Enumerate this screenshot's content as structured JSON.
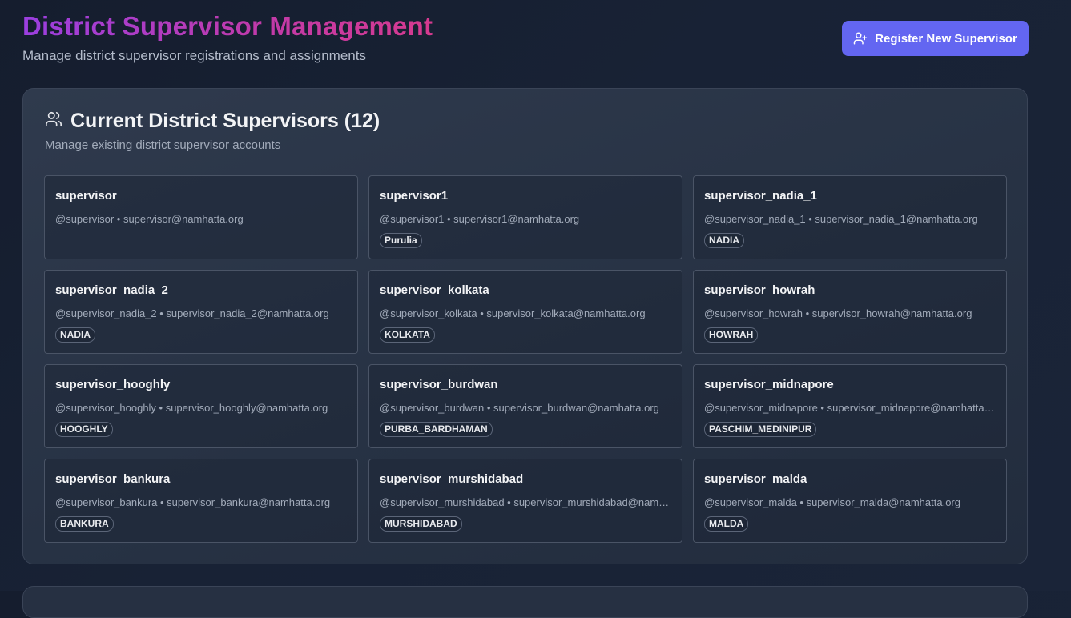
{
  "header": {
    "title": "District Supervisor Management",
    "subtitle": "Manage district supervisor registrations and assignments",
    "register_button": {
      "label": "Register New Supervisor",
      "icon": "user-plus-icon"
    }
  },
  "colors": {
    "accent": "#6366f1",
    "title_gradient_start": "#9b3fe0",
    "title_gradient_end": "#d63a8f",
    "background": "#182235"
  },
  "supervisors_panel": {
    "icon": "users-icon",
    "title": "Current District Supervisors (12)",
    "subtitle": "Manage existing district supervisor accounts",
    "items": [
      {
        "name": "supervisor",
        "meta": "@supervisor • supervisor@namhatta.org",
        "district": ""
      },
      {
        "name": "supervisor1",
        "meta": "@supervisor1 • supervisor1@namhatta.org",
        "district": "Purulia"
      },
      {
        "name": "supervisor_nadia_1",
        "meta": "@supervisor_nadia_1 • supervisor_nadia_1@namhatta.org",
        "district": "NADIA"
      },
      {
        "name": "supervisor_nadia_2",
        "meta": "@supervisor_nadia_2 • supervisor_nadia_2@namhatta.org",
        "district": "NADIA"
      },
      {
        "name": "supervisor_kolkata",
        "meta": "@supervisor_kolkata • supervisor_kolkata@namhatta.org",
        "district": "KOLKATA"
      },
      {
        "name": "supervisor_howrah",
        "meta": "@supervisor_howrah • supervisor_howrah@namhatta.org",
        "district": "HOWRAH"
      },
      {
        "name": "supervisor_hooghly",
        "meta": "@supervisor_hooghly • supervisor_hooghly@namhatta.org",
        "district": "HOOGHLY"
      },
      {
        "name": "supervisor_burdwan",
        "meta": "@supervisor_burdwan • supervisor_burdwan@namhatta.org",
        "district": "PURBA_BARDHAMAN"
      },
      {
        "name": "supervisor_midnapore",
        "meta": "@supervisor_midnapore • supervisor_midnapore@namhatta.org",
        "district": "PASCHIM_MEDINIPUR"
      },
      {
        "name": "supervisor_bankura",
        "meta": "@supervisor_bankura • supervisor_bankura@namhatta.org",
        "district": "BANKURA"
      },
      {
        "name": "supervisor_murshidabad",
        "meta": "@supervisor_murshidabad • supervisor_murshidabad@namhatta.org",
        "district": "MURSHIDABAD"
      },
      {
        "name": "supervisor_malda",
        "meta": "@supervisor_malda • supervisor_malda@namhatta.org",
        "district": "MALDA"
      }
    ]
  }
}
